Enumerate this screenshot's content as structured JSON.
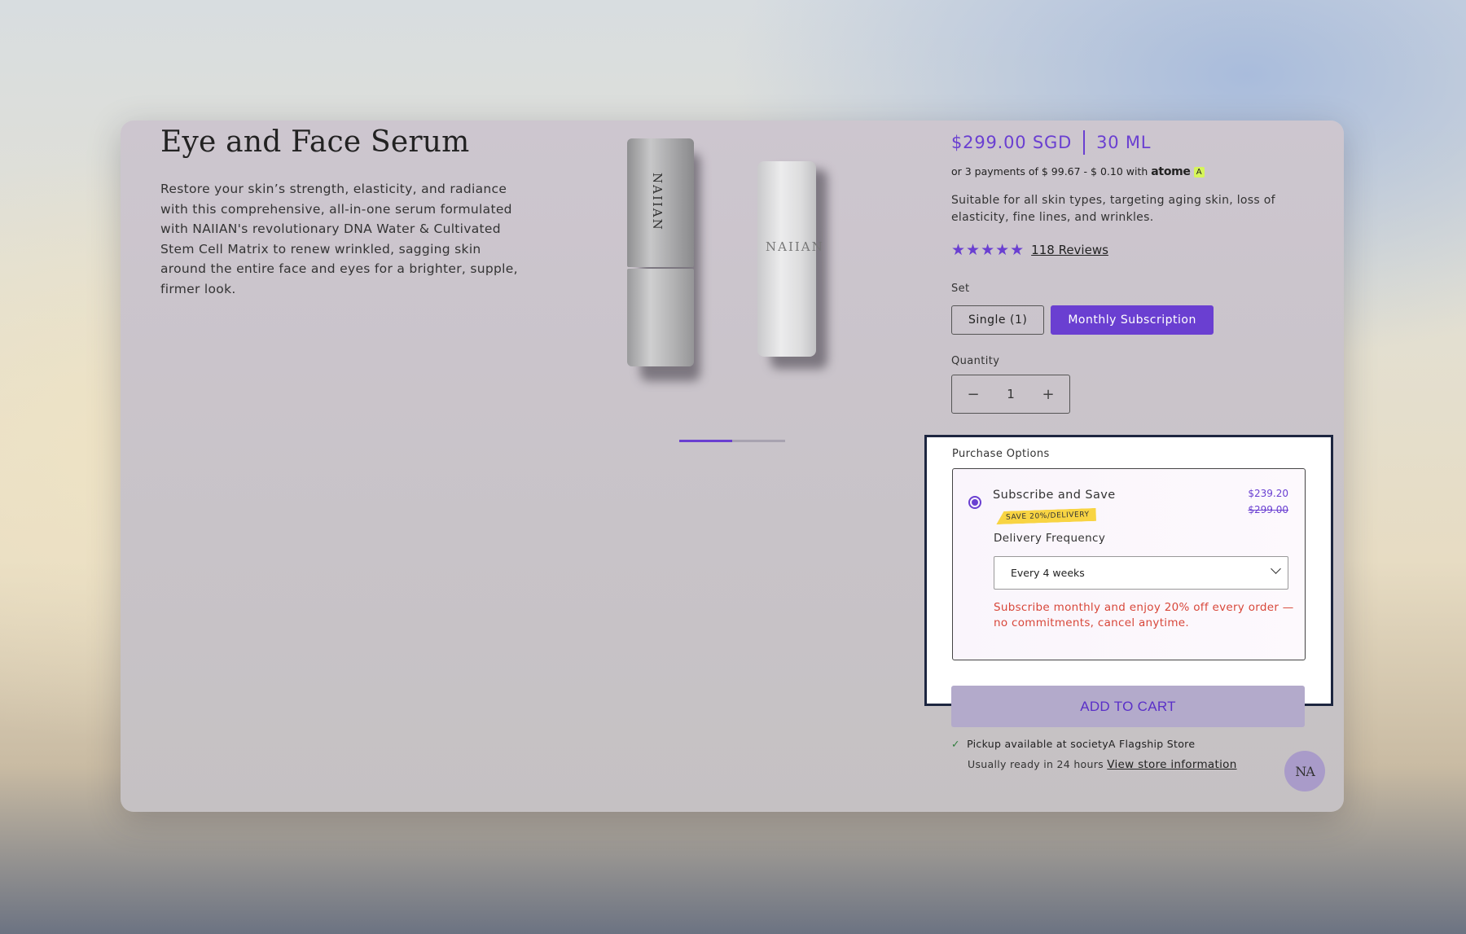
{
  "product": {
    "title": "Eye and Face Serum",
    "description": "Restore your skin’s strength, elasticity, and radiance with this comprehensive, all-in-one serum formulated with NAIIAN's revolutionary DNA Water & Cultivated Stem Cell Matrix to renew wrinkled, sagging skin around the entire face and eyes for a brighter, supple, firmer look.",
    "bottle_logo": "NAIIAN",
    "image_progress": 0.5
  },
  "pricing": {
    "price": "$299.00 SGD",
    "size": "30 ML",
    "installments_prefix": "or 3 payments of $ 99.67 - $ 0.10 with",
    "installments_brand": "atome",
    "installments_brand_mark": "A"
  },
  "details": {
    "suitable": "Suitable for all skin types, targeting aging skin, loss of elasticity, fine lines, and wrinkles.",
    "stars": "★★★★★",
    "rating": 5,
    "reviews": "118 Reviews"
  },
  "set": {
    "label": "Set",
    "options": [
      "Single (1)",
      "Monthly Subscription"
    ],
    "selected": "Monthly Subscription"
  },
  "quantity": {
    "label": "Quantity",
    "value": "1",
    "minus": "−",
    "plus": "+"
  },
  "purchase_options": {
    "title": "Purchase Options",
    "subscribe_title": "Subscribe and Save",
    "price": "$239.20",
    "old_price": "$299.00",
    "badge": "SAVE 20%/DELIVERY",
    "frequency_label": "Delivery Frequency",
    "frequency_value": "Every 4 weeks",
    "note": "Subscribe monthly and enjoy 20% off every order — no commitments, cancel anytime."
  },
  "cart": {
    "add_label": "ADD TO CART",
    "pickup_prefix": "Pickup available at",
    "pickup_store": "societyA Flagship Store",
    "ready_text": "Usually ready in 24 hours",
    "store_link": "View store information"
  },
  "chat": {
    "label": "NA"
  },
  "colors": {
    "accent": "#6a3fd1",
    "warning_text": "#d8473a",
    "badge": "#f8d443"
  }
}
